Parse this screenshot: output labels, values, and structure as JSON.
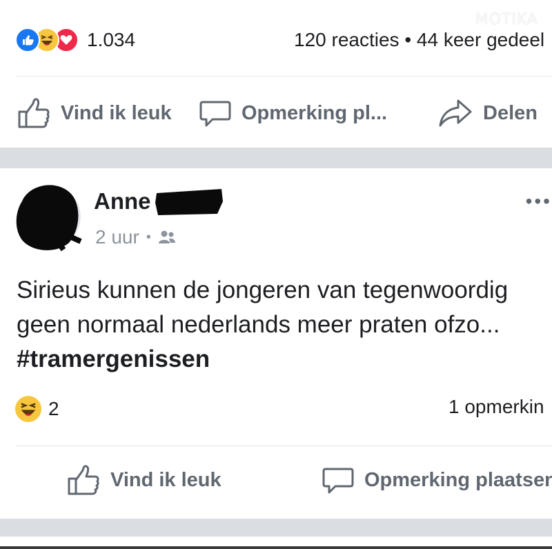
{
  "watermark": "MOTIKA",
  "post1": {
    "reaction_count": "1.034",
    "comments_shares": "120 reacties • 44 keer gedeel",
    "actions": {
      "like": "Vind ik leuk",
      "comment": "Opmerking pl...",
      "share": "Delen"
    },
    "reaction_icons": [
      "like-icon",
      "haha-icon",
      "love-icon"
    ]
  },
  "post2": {
    "author": "Anne",
    "time": "2 uur",
    "audience_icon": "friends-icon",
    "text_line1": "Sirieus kunnen de jongeren van tegenwoordig",
    "text_line2": "geen normaal nederlands meer praten ofzo...",
    "hashtag": "#tramergenissen",
    "reaction_count": "2",
    "comments": "1 opmerkin",
    "actions": {
      "like": "Vind ik leuk",
      "comment": "Opmerking plaatsen"
    }
  },
  "colors": {
    "like_blue": "#1877f2",
    "haha_yellow": "#f7c63f",
    "love_red": "#f0284a",
    "secondary_text": "#606770",
    "separator": "#dadde1"
  }
}
